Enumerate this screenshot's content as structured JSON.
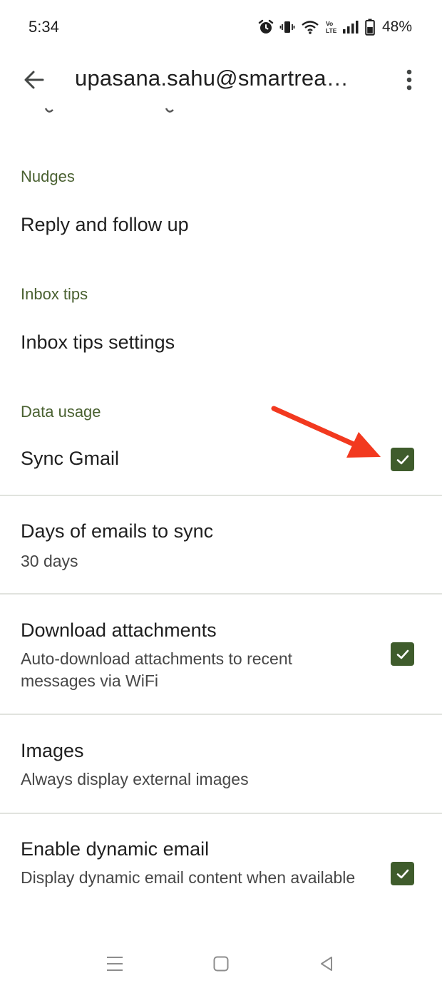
{
  "status_bar": {
    "time": "5:34",
    "battery": "48%",
    "icons": [
      "alarm-icon",
      "vibrate-icon",
      "wifi-icon",
      "volte-icon",
      "signal-icon",
      "battery-icon"
    ]
  },
  "app_bar": {
    "title": "upasana.sahu@smartrea…",
    "back_icon": "arrow-back-icon",
    "menu_icon": "more-vert-icon"
  },
  "sections": {
    "nudges": {
      "header": "Nudges",
      "item": "Reply and follow up"
    },
    "inbox_tips": {
      "header": "Inbox tips",
      "item": "Inbox tips settings"
    },
    "data_usage": {
      "header": "Data usage",
      "sync_gmail": {
        "title": "Sync Gmail",
        "checked": true
      },
      "days_to_sync": {
        "title": "Days of emails to sync",
        "subtitle": "30 days"
      },
      "download_attachments": {
        "title": "Download attachments",
        "subtitle": "Auto-download attachments to recent messages via WiFi",
        "checked": true
      },
      "images": {
        "title": "Images",
        "subtitle": "Always display external images"
      },
      "dynamic_email": {
        "title": "Enable dynamic email",
        "subtitle": "Display dynamic email content when available",
        "checked": true
      }
    }
  },
  "colors": {
    "section_header": "#4a6131",
    "checkbox": "#3f5c2c",
    "annotation_arrow": "#f2391f"
  },
  "nav_bar": {
    "icons": [
      "recents-icon",
      "home-icon",
      "back-triangle-icon"
    ]
  }
}
